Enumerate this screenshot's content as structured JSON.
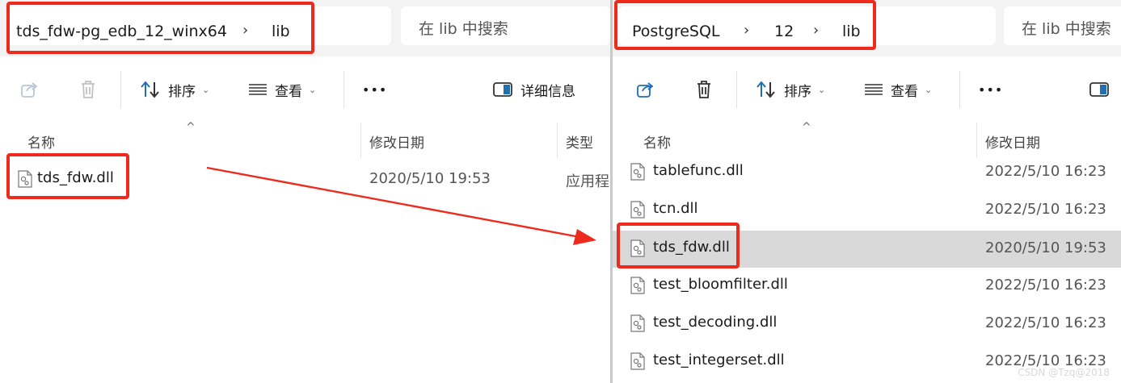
{
  "left": {
    "breadcrumb": [
      "tds_fdw-pg_edb_12_winx64",
      "lib"
    ],
    "search_placeholder": "在 lib 中搜索",
    "toolbar": {
      "sort": "排序",
      "view": "查看",
      "more": "•••",
      "details": "详细信息"
    },
    "columns": {
      "name": "名称",
      "modified": "修改日期",
      "type": "类型"
    },
    "rows": [
      {
        "name": "tds_fdw.dll",
        "modified": "2020/5/10 19:53",
        "type": "应用程"
      }
    ]
  },
  "right": {
    "breadcrumb": [
      "PostgreSQL",
      "12",
      "lib"
    ],
    "search_placeholder": "在 lib 中搜索",
    "toolbar": {
      "sort": "排序",
      "view": "查看",
      "more": "•••"
    },
    "columns": {
      "name": "名称",
      "modified": "修改日期"
    },
    "rows": [
      {
        "name": "tablefunc.dll",
        "modified": "2022/5/10 16:23"
      },
      {
        "name": "tcn.dll",
        "modified": "2022/5/10 16:23"
      },
      {
        "name": "tds_fdw.dll",
        "modified": "2020/5/10 19:53",
        "selected": true
      },
      {
        "name": "test_bloomfilter.dll",
        "modified": "2022/5/10 16:23"
      },
      {
        "name": "test_decoding.dll",
        "modified": "2022/5/10 16:23"
      },
      {
        "name": "test_integerset.dll",
        "modified": "2022/5/10 16:23"
      }
    ]
  },
  "watermark": "CSDN @Tzq@2018",
  "colors": {
    "highlight": "#ee2a1c",
    "selected_row": "#d9d9d9",
    "bar": "#f3f3f3"
  }
}
